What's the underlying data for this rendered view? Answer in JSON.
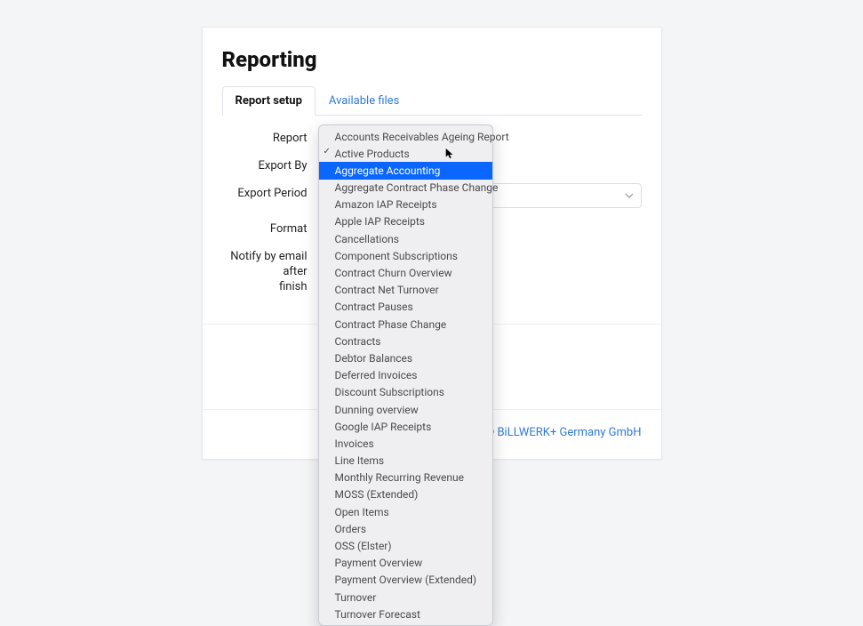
{
  "page": {
    "title": "Reporting"
  },
  "tabs": {
    "setup": "Report setup",
    "files": "Available files"
  },
  "form": {
    "report_label": "Report",
    "export_by_label": "Export By",
    "export_period_label": "Export Period",
    "format_label": "Format",
    "notify_label_line1": "Notify by email after",
    "notify_label_line2": "finish",
    "export_period_value": ""
  },
  "dropdown": {
    "selected": "Active Products",
    "highlighted": "Aggregate Accounting",
    "items": [
      "Accounts Receivables Ageing Report",
      "Active Products",
      "Aggregate Accounting",
      "Aggregate Contract Phase Change",
      "Amazon IAP Receipts",
      "Apple IAP Receipts",
      "Cancellations",
      "Component Subscriptions",
      "Contract Churn Overview",
      "Contract Net Turnover",
      "Contract Pauses",
      "Contract Phase Change",
      "Contracts",
      "Debtor Balances",
      "Deferred Invoices",
      "Discount Subscriptions",
      "Dunning overview",
      "Google IAP Receipts",
      "Invoices",
      "Line Items",
      "Monthly Recurring Revenue",
      "MOSS (Extended)",
      "Open Items",
      "Orders",
      "OSS (Elster)",
      "Payment Overview",
      "Payment Overview (Extended)",
      "Turnover",
      "Turnover Forecast"
    ]
  },
  "footer": {
    "copyright_prefix": "© ",
    "brand": "BiLLWERK+ Germany GmbH"
  }
}
